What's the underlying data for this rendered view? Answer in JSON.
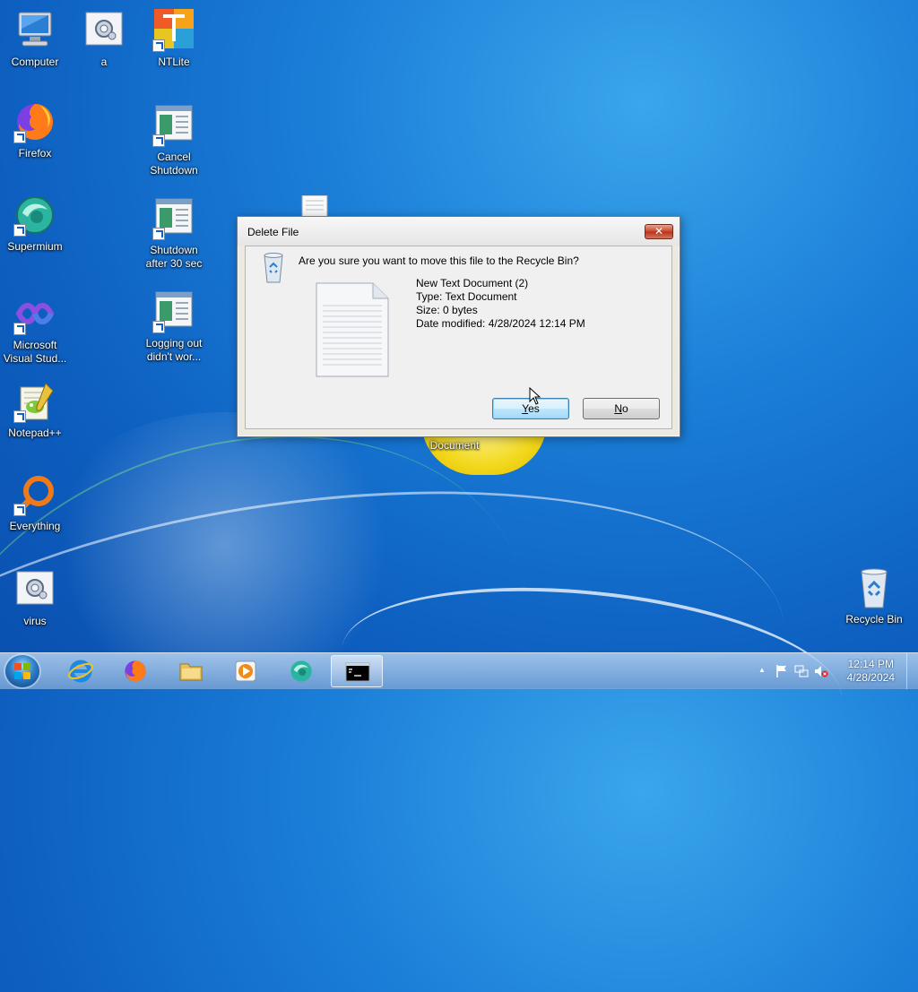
{
  "desktop": {
    "icons": [
      {
        "label": "Computer"
      },
      {
        "label": "a"
      },
      {
        "label": "NTLite"
      },
      {
        "label": "Firefox"
      },
      {
        "label": "Cancel Shutdown"
      },
      {
        "label": "Supermium"
      },
      {
        "label": "Shutdown after 30 sec"
      },
      {
        "label": "Microsoft Visual Stud..."
      },
      {
        "label": "Logging out didn't wor..."
      },
      {
        "label": "Notepad++"
      },
      {
        "label": "Everything"
      },
      {
        "label": "virus"
      },
      {
        "label": "Recycle Bin"
      },
      {
        "label": "Document"
      }
    ]
  },
  "dialog": {
    "title": "Delete File",
    "close_label": "✕",
    "question": "Are you sure you want to move this file to the Recycle Bin?",
    "file": {
      "name": "New Text Document (2)",
      "type": "Type: Text Document",
      "size": "Size: 0 bytes",
      "modified": "Date modified: 4/28/2024 12:14 PM"
    },
    "yes_label_accel": "Y",
    "yes_label_rest": "es",
    "no_label_accel": "N",
    "no_label_rest": "o"
  },
  "taskbar": {
    "items": [
      "internet-explorer",
      "firefox",
      "file-explorer",
      "media-player",
      "supermium",
      "command-prompt"
    ],
    "tray": {
      "time": "12:14 PM",
      "date": "4/28/2024",
      "overflow_glyph": "▲"
    }
  },
  "colors": {
    "desktop_blue": "#1b7fd8",
    "yes_button_border": "#3c7fb1",
    "close_red": "#c7462b"
  }
}
